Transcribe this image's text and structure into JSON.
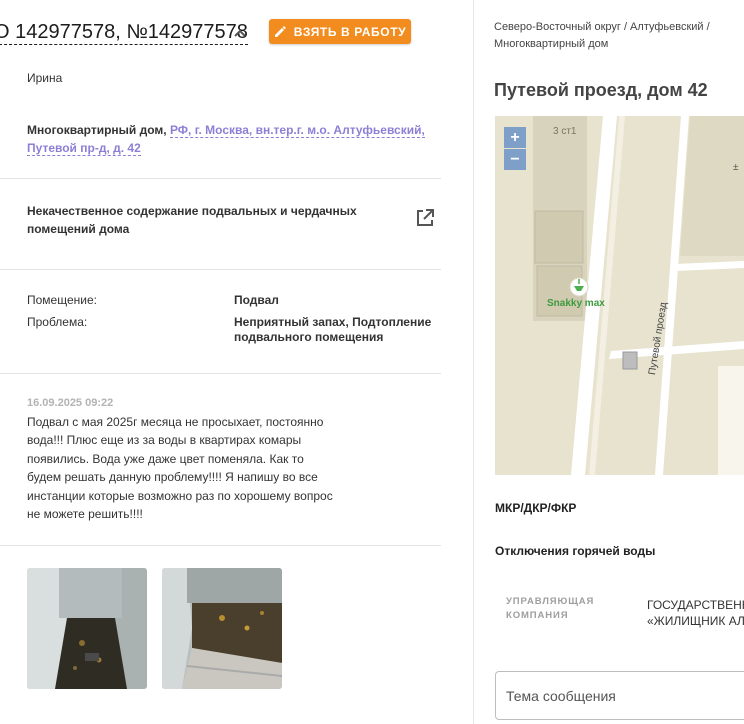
{
  "complaint": {
    "title": "О 142977578, №142977578",
    "action_label": "ВЗЯТЬ В РАБОТУ",
    "author": "Ирина",
    "address_prefix": "Многоквартирный дом,",
    "address_link": "РФ, г. Москва, вн.тер.г. м.о. Алтуфьевский, Путевой пр-д, д. 42",
    "issue": "Некачественное содержание подвальных и чердачных помещений дома",
    "details": [
      {
        "label": "Помещение:",
        "value": "Подвал"
      },
      {
        "label": "Проблема:",
        "value": "Неприятный запах, Подтопление подвального помещения"
      }
    ],
    "message_date": "16.09.2025 09:22",
    "message_text": "Подвал с мая 2025г месяца не просыхает, постоянно вода!!! Плюс еще из за воды в квартирах комары появились. Вода уже даже цвет поменяла. Как то будем решать данную проблему!!!! Я напишу во все инстанции которые возможно раз по хорошему вопрос не можете решить!!!!",
    "photos": [
      "basement-photo-1",
      "basement-photo-2"
    ]
  },
  "details_panel": {
    "breadcrumb": "Северо-Восточный округ / Алтуфьевский / Многоквартирный дом",
    "place_title": "Путевой проезд, дом 42",
    "map": {
      "zoom_in": "+",
      "zoom_out": "−",
      "building_label": "3 ст1",
      "poi_label": "Snakky max",
      "street_label": "Путевой проезд"
    },
    "section_mkr": "МКР/ДКР/ФКР",
    "section_hot_water": "Отключения горячей воды",
    "management_label_1": "УПРАВЛЯЮЩАЯ",
    "management_label_2": "КОМПАНИЯ",
    "management_value_1": "ГОСУДАРСТВЕННОЕ БЮДЖЕТНОЕ",
    "management_value_2": "«ЖИЛИЩНИК АЛТУФЬЕВСКИЙ»",
    "message_subject_placeholder": "Тема сообщения"
  },
  "colors": {
    "accent": "#f28c1e",
    "link": "#8e7fd6",
    "map_bg": "#e7e3cf",
    "zoom": "#7ea0c8"
  }
}
